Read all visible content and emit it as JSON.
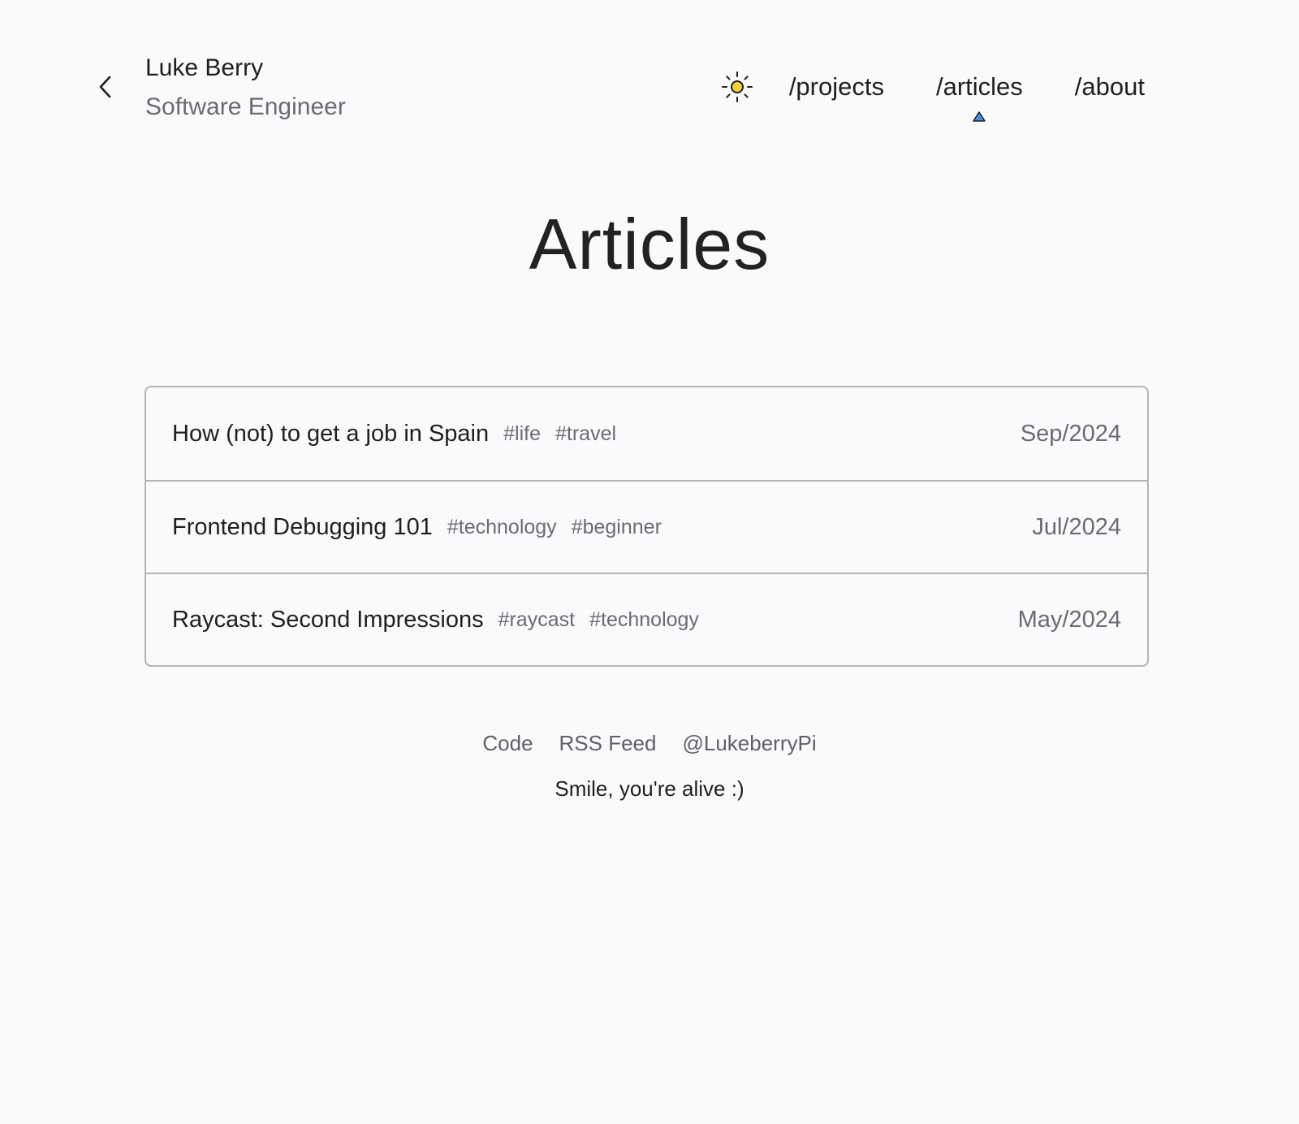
{
  "header": {
    "name": "Luke Berry",
    "role": "Software Engineer",
    "back_icon": "chevron-left-icon",
    "theme_icon": "sun-icon"
  },
  "nav": {
    "links": [
      {
        "label": "/projects",
        "active": false
      },
      {
        "label": "/articles",
        "active": true
      },
      {
        "label": "/about",
        "active": false
      }
    ],
    "indicator_color": "#4a90d9"
  },
  "main": {
    "title": "Articles",
    "articles": [
      {
        "title": "How (not) to get a job in Spain",
        "tags": [
          "#life",
          "#travel"
        ],
        "date": "Sep/2024"
      },
      {
        "title": "Frontend Debugging 101",
        "tags": [
          "#technology",
          "#beginner"
        ],
        "date": "Jul/2024"
      },
      {
        "title": "Raycast: Second Impressions",
        "tags": [
          "#raycast",
          "#technology"
        ],
        "date": "May/2024"
      }
    ]
  },
  "footer": {
    "links": [
      "Code",
      "RSS Feed",
      "@LukeberryPi"
    ],
    "tagline": "Smile, you're alive :)"
  },
  "colors": {
    "background": "#fafafa",
    "text": "#1f1f1f",
    "muted": "#6b6b73",
    "border": "#b4b4ba",
    "sun": "#f5d33d"
  }
}
